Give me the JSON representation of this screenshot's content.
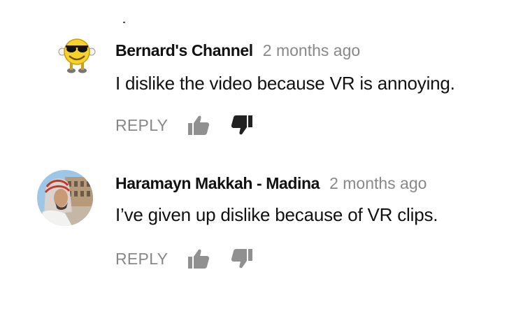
{
  "comments": [
    {
      "author": "Bernard's Channel",
      "time": "2 months ago",
      "text": "I dislike the video because VR is annoying.",
      "reply_label": "REPLY",
      "avatar_icon": "sunglasses-smiley-icon"
    },
    {
      "author": "Haramayn Makkah - Madina",
      "time": "2 months ago",
      "text": "I’ve given up dislike because of VR clips.",
      "reply_label": "REPLY",
      "avatar_icon": "user-photo-avatar"
    }
  ],
  "icons": {
    "like": "thumbs-up-icon",
    "dislike": "thumbs-down-icon"
  },
  "colors": {
    "author": "#111111",
    "muted": "#888888",
    "icon": "#909090"
  }
}
